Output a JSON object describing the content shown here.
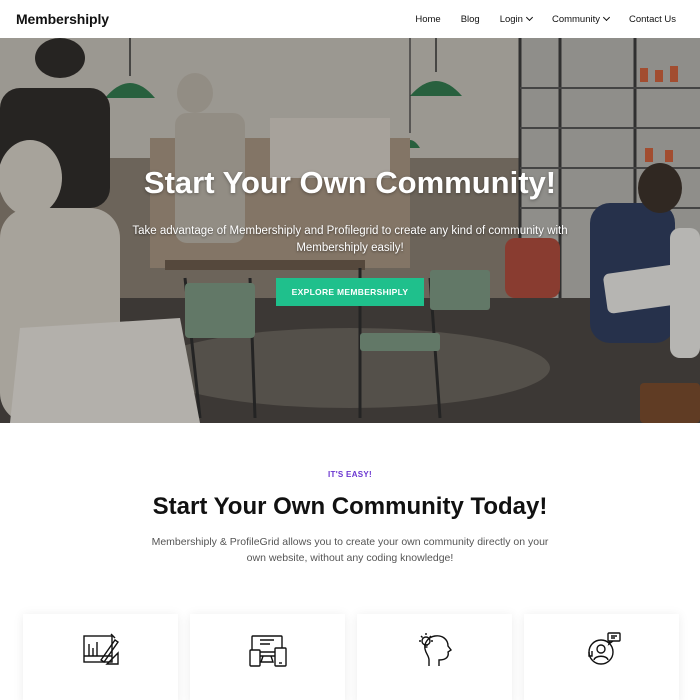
{
  "header": {
    "brand": "Membershiply",
    "nav": [
      {
        "label": "Home",
        "has_dropdown": false
      },
      {
        "label": "Blog",
        "has_dropdown": false
      },
      {
        "label": "Login",
        "has_dropdown": true
      },
      {
        "label": "Community",
        "has_dropdown": true
      },
      {
        "label": "Contact Us",
        "has_dropdown": false
      }
    ]
  },
  "hero": {
    "title": "Start Your Own Community!",
    "subtitle": "Take advantage of Membershiply and Profilegrid to create any kind of community with Membershiply easily!",
    "cta_label": "EXPLORE MEMBERSHIPLY"
  },
  "section": {
    "eyebrow": "IT'S EASY!",
    "title": "Start Your Own Community Today!",
    "description": "Membershiply & ProfileGrid allows you to create your own community directly on your own website, without any coding knowledge!"
  },
  "cards": [
    {
      "icon": "drafting-tools-icon"
    },
    {
      "icon": "devices-icon"
    },
    {
      "icon": "idea-head-icon"
    },
    {
      "icon": "support-agent-icon"
    }
  ],
  "colors": {
    "accent_button": "#1fc08c",
    "eyebrow": "#6a35d0"
  }
}
